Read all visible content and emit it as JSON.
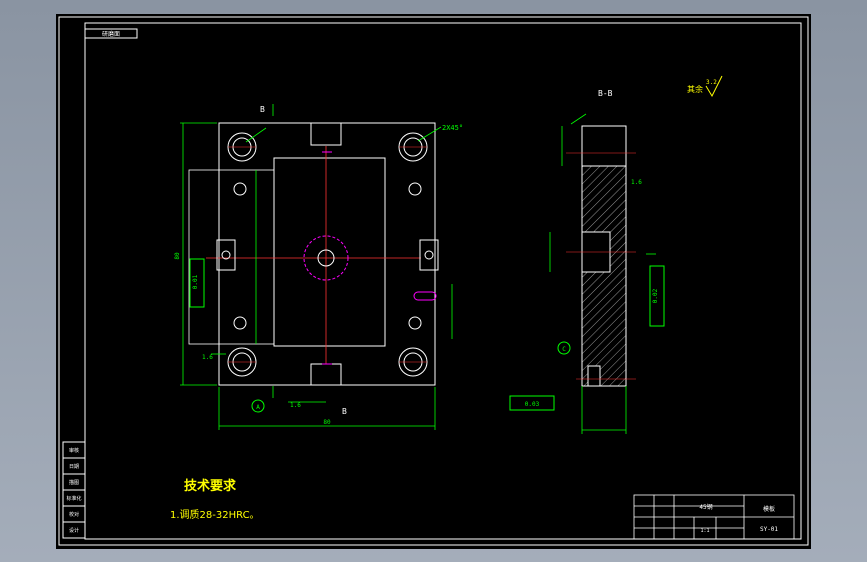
{
  "drawing": {
    "corner_tag": "研磨面",
    "section_marker": "B",
    "view_label": "B-B",
    "roughness_rest_label": "其余",
    "roughness_rest_value": "3.2",
    "chamfer_note": "2X45°",
    "flatness_tol": "0.01",
    "parallelism_tol": "0.02",
    "perp_tol": "0.03",
    "datum_a": "A",
    "datum_c": "C",
    "roughness_value": "1.6",
    "overall_width": "80",
    "overall_height": "80",
    "tech_req_title": "技术要求",
    "tech_req_line1": "1.调质28-32HRC。",
    "side_labels": [
      "审核",
      "日期",
      "描图",
      "标准化",
      "校对",
      "设计"
    ],
    "title_block": {
      "part_name": "模板",
      "material": "45钢",
      "scale": "1:1",
      "drawing_no": "SY-01"
    }
  },
  "colors": {
    "background": "#000000",
    "border": "#ffffff",
    "geometry": "#ffffff",
    "dimension": "#00ff00",
    "centerline": "#ff3333",
    "hidden": "#ff00ff",
    "text_yellow": "#ffff00"
  }
}
